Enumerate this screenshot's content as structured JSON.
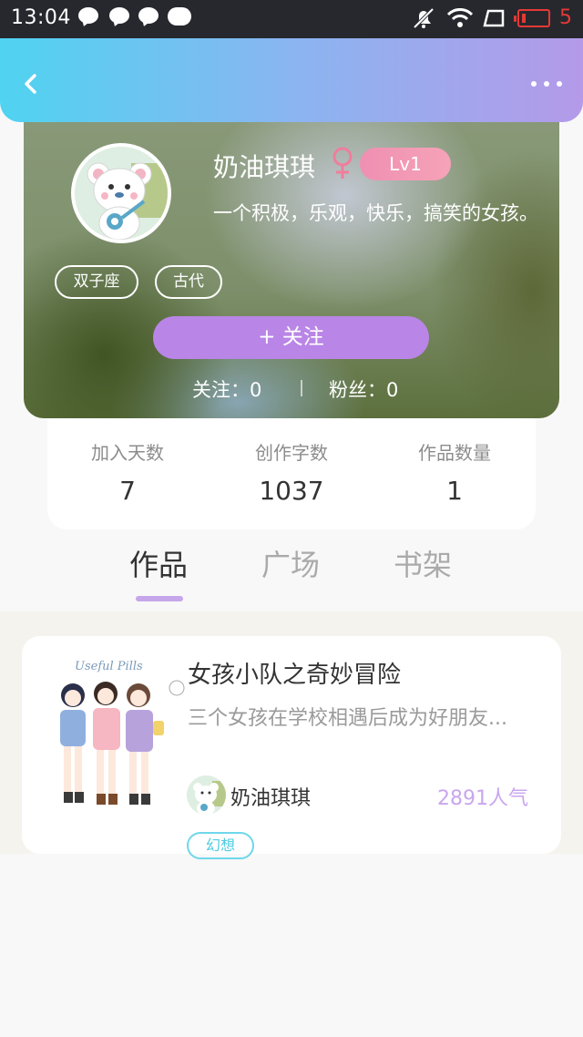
{
  "status_bar": {
    "time": "13:04",
    "battery_level": "5"
  },
  "header": {
    "back_icon": "chevron-left-icon",
    "more_icon": "more-horizontal-icon"
  },
  "profile": {
    "username": "奶油琪琪",
    "gender_icon": "female-icon",
    "level": "Lv1",
    "bio": "一个积极，乐观，快乐，搞笑的女孩。",
    "tags": [
      "双子座",
      "古代"
    ],
    "follow_button": "+   关注",
    "following": "关注：0",
    "followers": "粉丝：0"
  },
  "stats": [
    {
      "label": "加入天数",
      "value": "7"
    },
    {
      "label": "创作字数",
      "value": "1037"
    },
    {
      "label": "作品数量",
      "value": "1"
    }
  ],
  "tabs": [
    {
      "label": "作品",
      "active": true
    },
    {
      "label": "广场",
      "active": false
    },
    {
      "label": "书架",
      "active": false
    }
  ],
  "works": [
    {
      "title": "女孩小队之奇妙冒险",
      "description": "三个女孩在学校相遇后成为好朋友...",
      "author": "奶油琪琪",
      "popularity": "2891人气",
      "genre": "幻想",
      "cover_text": "Useful Pills"
    }
  ],
  "colors": {
    "accent_purple": "#b985e6",
    "header_gradient_start": "#4fd3f0",
    "header_gradient_end": "#b49ae9",
    "genre_cyan": "#4fcbe2",
    "popularity_purple": "#c9a6ee"
  }
}
